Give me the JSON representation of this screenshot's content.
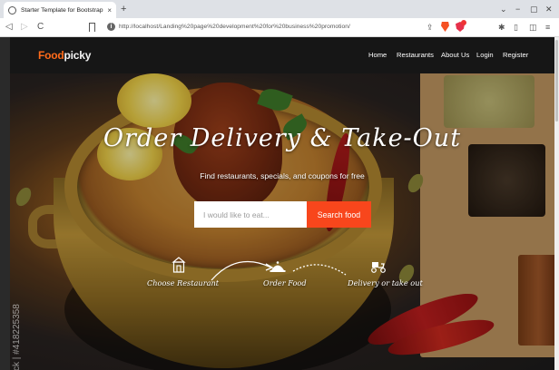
{
  "browser": {
    "tab_title": "Starter Template for Bootstrap",
    "tab_close": "×",
    "new_tab": "+",
    "url": "http://localhost/Landing%20page%20development%20for%20business%20promotion/",
    "win_chevron": "⌄",
    "win_minimize": "−",
    "win_restore": "▢",
    "win_close": "✕"
  },
  "site": {
    "logo_food": "Food",
    "logo_picky": "picky",
    "nav": {
      "home": "Home",
      "restaurants": "Restaurants",
      "about": "About Us",
      "login": "Login",
      "register": "Register"
    },
    "hero": {
      "title": "Order Delivery & Take-Out",
      "subtitle": "Find restaurants, specials, and coupons for free",
      "search_placeholder": "I would like to eat...",
      "search_button": "Search food"
    },
    "steps": {
      "choose": "Choose Restaurant",
      "order": "Order Food",
      "delivery": "Delivery or take out"
    },
    "watermark": "ck | #418225358"
  },
  "colors": {
    "accent": "#f8461c",
    "logo_orange": "#ff6b1a",
    "navbar": "#161616"
  }
}
